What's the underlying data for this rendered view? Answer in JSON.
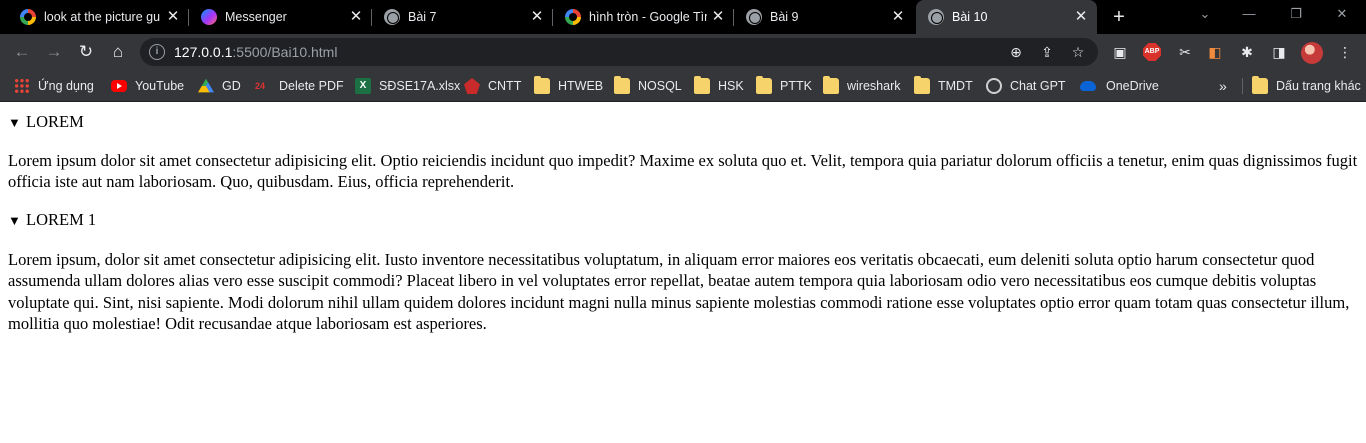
{
  "tabs": [
    {
      "title": "look at the picture gue",
      "favicon": "google-icon"
    },
    {
      "title": "Messenger",
      "favicon": "messenger-icon"
    },
    {
      "title": "Bài 7",
      "favicon": "globe-icon"
    },
    {
      "title": "hình tròn - Google Tìm",
      "favicon": "google-icon"
    },
    {
      "title": "Bài 9",
      "favicon": "globe-icon"
    },
    {
      "title": "Bài 10",
      "favicon": "globe-icon",
      "active": true
    }
  ],
  "address_bar": {
    "host": "127.0.0.1",
    "rest": ":5500/Bai10.html"
  },
  "bookmarks": [
    {
      "label": "Ứng dụng",
      "icon": "apps-icon"
    },
    {
      "label": "YouTube",
      "icon": "youtube-icon"
    },
    {
      "label": "GD",
      "icon": "google-drive-icon"
    },
    {
      "label": "Delete PDF",
      "icon": "pdf-icon"
    },
    {
      "label": "SĐSE17A.xlsx",
      "icon": "excel-icon"
    },
    {
      "label": "CNTT",
      "icon": "cntt-icon"
    },
    {
      "label": "HTWEB",
      "icon": "folder-icon"
    },
    {
      "label": "NOSQL",
      "icon": "folder-icon"
    },
    {
      "label": "HSK",
      "icon": "folder-icon"
    },
    {
      "label": "PTTK",
      "icon": "folder-icon"
    },
    {
      "label": "wireshark",
      "icon": "folder-icon"
    },
    {
      "label": "TMDT",
      "icon": "folder-icon"
    },
    {
      "label": "Chat GPT",
      "icon": "chatgpt-icon"
    },
    {
      "label": "OneDrive",
      "icon": "onedrive-icon"
    }
  ],
  "other_bookmarks": {
    "label": "Dấu trang khác",
    "icon": "folder-icon"
  },
  "extensions": {
    "abp_label": "ABP"
  },
  "content": {
    "sections": [
      {
        "summary": "LOREM",
        "body": "Lorem ipsum dolor sit amet consectetur adipisicing elit. Optio reiciendis incidunt quo impedit? Maxime ex soluta quo et. Velit, tempora quia pariatur dolorum officiis a tenetur, enim quas dignissimos fugit officia iste aut nam laboriosam. Quo, quibusdam. Eius, officia reprehenderit."
      },
      {
        "summary": "LOREM 1",
        "body": "Lorem ipsum, dolor sit amet consectetur adipisicing elit. Iusto inventore necessitatibus voluptatum, in aliquam error maiores eos veritatis obcaecati, eum deleniti soluta optio harum consectetur quod assumenda ullam dolores alias vero esse suscipit commodi? Placeat libero in vel voluptates error repellat, beatae autem tempora quia laboriosam odio vero necessitatibus eos cumque debitis voluptas voluptate qui. Sint, nisi sapiente. Modi dolorum nihil ullam quidem dolores incidunt magni nulla minus sapiente molestias commodi ratione esse voluptates optio error quam totam quas consectetur illum, mollitia quo molestiae! Odit recusandae atque laboriosam est asperiores."
      }
    ]
  },
  "colors": {
    "tabstrip_bg": "#000000",
    "toolbar_bg": "#35363a",
    "omnibox_bg": "#202124",
    "page_bg": "#ffffff"
  }
}
